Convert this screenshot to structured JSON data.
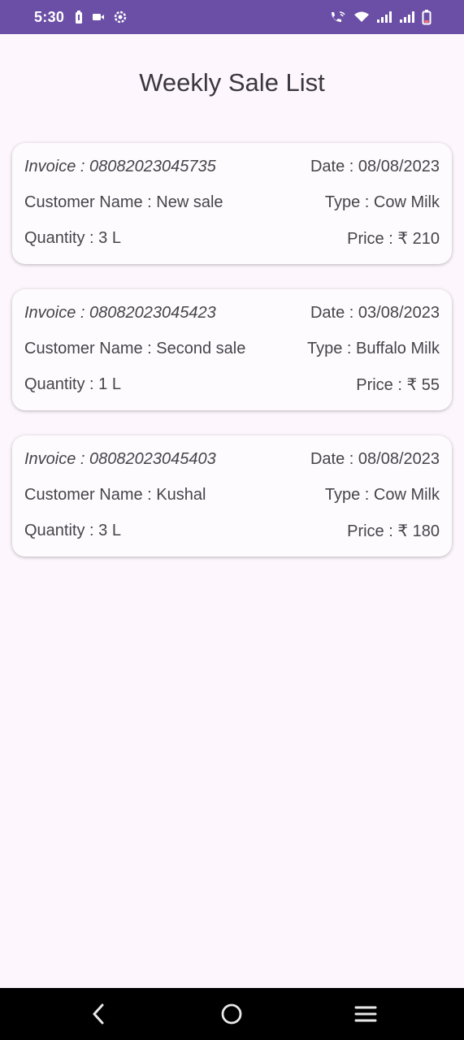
{
  "status_bar": {
    "time": "5:30",
    "background_color": "#6b4fa6",
    "left_icons": [
      "battery-saver-icon",
      "video-icon",
      "settings-icon"
    ],
    "right_icons": [
      "wifi-calling-icon",
      "wifi-icon",
      "signal-icon",
      "signal-icon",
      "battery-icon"
    ]
  },
  "page": {
    "title": "Weekly Sale List"
  },
  "sales": [
    {
      "invoice": "Invoice : 08082023045735",
      "date": "Date : 08/08/2023",
      "customer": "Customer Name : New sale",
      "type": "Type : Cow Milk",
      "quantity": "Quantity : 3 L",
      "price": "Price : ₹ 210"
    },
    {
      "invoice": "Invoice : 08082023045423",
      "date": "Date : 03/08/2023",
      "customer": "Customer Name : Second sale",
      "type": "Type : Buffalo Milk",
      "quantity": "Quantity : 1 L",
      "price": "Price : ₹ 55"
    },
    {
      "invoice": "Invoice : 08082023045403",
      "date": "Date : 08/08/2023",
      "customer": "Customer Name : Kushal",
      "type": "Type : Cow Milk",
      "quantity": "Quantity : 3 L",
      "price": "Price : ₹ 180"
    }
  ],
  "nav_bar": {
    "buttons": [
      "back-icon",
      "home-icon",
      "recents-icon"
    ]
  }
}
